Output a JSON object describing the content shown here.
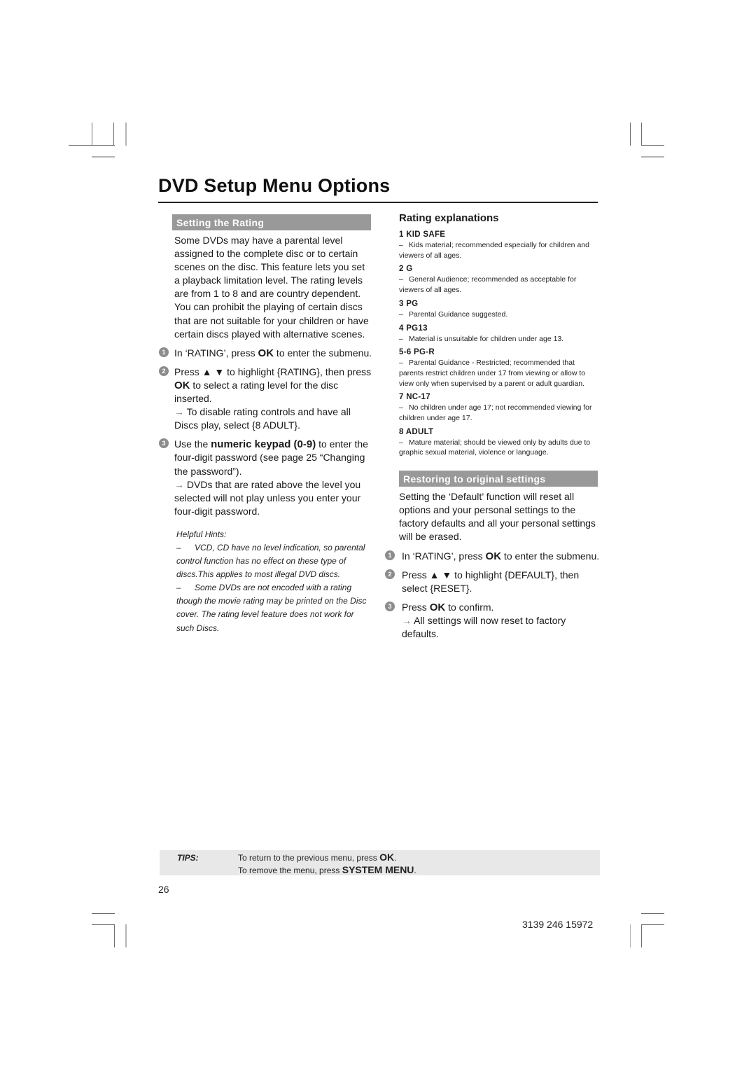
{
  "page": {
    "title": "DVD Setup Menu Options",
    "page_number": "26",
    "doc_code": "3139 246 15972"
  },
  "setting_rating": {
    "heading": "Setting the Rating",
    "intro": "Some DVDs may have a parental level assigned to the complete disc or to certain scenes on the disc. This feature lets you set a playback limitation level. The rating levels are from 1 to 8 and are country dependent. You can prohibit the playing of certain discs that are not suitable for your children or have certain discs played with alternative scenes.",
    "steps": [
      {
        "num": "1",
        "pre": "In ‘RATING’, press ",
        "key": "OK",
        "post": " to enter the submenu.",
        "result": ""
      },
      {
        "num": "2",
        "pre": "Press ▲ ▼ to highlight {RATING}, then press ",
        "key": "OK",
        "post": " to select a rating level for the disc inserted.",
        "result": "To disable rating controls and have all Discs play, select {8 ADULT}."
      },
      {
        "num": "3",
        "pre": "Use the ",
        "key": "numeric keypad (0-9)",
        "post": " to enter the four-digit password (see page 25 “Changing the password”).",
        "result": "DVDs that are rated above the level you selected will not play unless you enter your four-digit password."
      }
    ],
    "hints_title": "Helpful Hints:",
    "hints": [
      "VCD, CD have no level indication, so parental control function has no effect on these type of discs.This applies to most illegal DVD discs.",
      "Some DVDs are not encoded with a rating though the movie rating may be printed on the Disc cover. The rating level feature does not work for such Discs."
    ]
  },
  "rating_explanations": {
    "heading": "Rating explanations",
    "items": [
      {
        "name": "1 KID SAFE",
        "desc": "Kids material; recommended especially for children and viewers of all ages."
      },
      {
        "name": "2 G",
        "desc": "General Audience; recommended as acceptable for viewers of all ages."
      },
      {
        "name": "3 PG",
        "desc": "Parental Guidance suggested."
      },
      {
        "name": "4 PG13",
        "desc": "Material is unsuitable for children under age 13."
      },
      {
        "name": "5-6 PG-R",
        "desc": "Parental Guidance - Restricted; recommended that parents restrict children under 17 from viewing or allow to view only when supervised by a parent or adult guardian."
      },
      {
        "name": "7 NC-17",
        "desc": "No children under age 17; not recommended viewing for children under age 17."
      },
      {
        "name": "8 ADULT",
        "desc": "Mature material; should be viewed only by adults due to graphic sexual material, violence or language."
      }
    ]
  },
  "restoring": {
    "heading": "Restoring to original settings",
    "intro": "Setting the ‘Default’ function will reset all options and your personal settings to the factory defaults and all your personal settings will be erased.",
    "steps": [
      {
        "num": "1",
        "pre": "In ‘RATING’, press ",
        "key": "OK",
        "post": " to enter the submenu.",
        "result": ""
      },
      {
        "num": "2",
        "pre": "Press ▲ ▼ to highlight {DEFAULT}, then select {RESET}.",
        "key": "",
        "post": "",
        "result": ""
      },
      {
        "num": "3",
        "pre": "Press ",
        "key": "OK",
        "post": " to confirm.",
        "result": "All settings will now reset to factory defaults."
      }
    ]
  },
  "tips": {
    "label": "TIPS:",
    "line1_pre": "To return to the previous menu, press ",
    "line1_key": "OK",
    "line1_post": ".",
    "line2_pre": "To remove the menu, press ",
    "line2_key": "SYSTEM MENU",
    "line2_post": "."
  },
  "icons": {
    "arrow": "→"
  }
}
